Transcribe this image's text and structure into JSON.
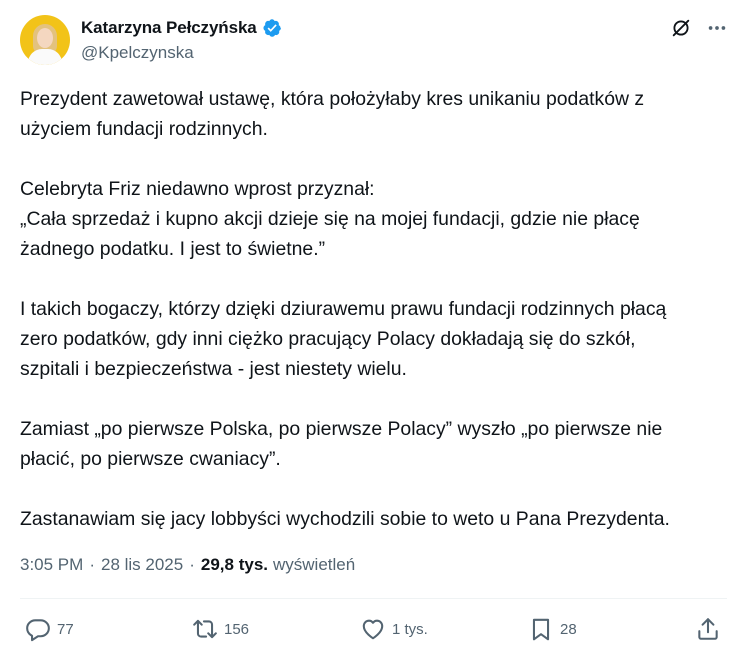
{
  "author": {
    "name": "Katarzyna Pełczyńska",
    "handle": "@Kpelczynska"
  },
  "tweet": {
    "paragraphs": [
      [
        "Prezydent zawetował ustawę, która położyłaby kres unikaniu podatków z",
        "użyciem fundacji rodzinnych."
      ],
      [
        "Celebryta Friz niedawno wprost przyznał:",
        "„Cała sprzedaż i kupno akcji dzieje się na mojej fundacji, gdzie nie płacę",
        "żadnego podatku. I jest to świetne.”"
      ],
      [
        "I takich bogaczy, którzy dzięki dziurawemu prawu fundacji rodzinnych płacą",
        "zero podatków, gdy inni ciężko pracujący Polacy dokładają się do szkół,",
        "szpitali i bezpieczeństwa - jest niestety wielu."
      ],
      [
        "Zamiast „po pierwsze Polska, po pierwsze Polacy” wyszło „po pierwsze nie",
        "płacić, po pierwsze cwaniacy”."
      ],
      [
        "Zastanawiam się jacy lobbyści wychodzili sobie to weto u Pana Prezydenta."
      ]
    ]
  },
  "meta": {
    "time": "3:05 PM",
    "date": "28 lis 2025",
    "views_count": "29,8 tys.",
    "views_label": "wyświetleń"
  },
  "actions": {
    "replies": "77",
    "retweets": "156",
    "likes": "1 tys.",
    "bookmarks": "28"
  },
  "colors": {
    "text": "#0f1419",
    "secondary": "#536471",
    "verified": "#1d9bf0",
    "avatar_bg": "#f2c318"
  },
  "icons": [
    "verified-badge-icon",
    "grok-icon",
    "more-icon",
    "reply-icon",
    "retweet-icon",
    "like-icon",
    "bookmark-icon",
    "share-icon"
  ]
}
